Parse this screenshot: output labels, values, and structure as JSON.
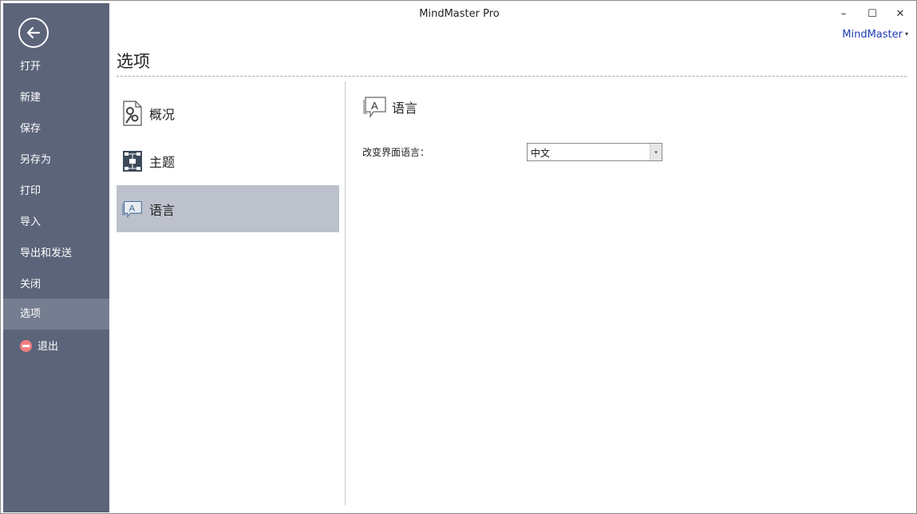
{
  "window": {
    "title": "MindMaster Pro",
    "controls": {
      "minimize": "–",
      "maximize": "☐",
      "close": "✕"
    },
    "brand_label": "MindMaster",
    "brand_caret": "▾"
  },
  "sidebar": {
    "back_icon": "back-arrow-icon",
    "items": [
      {
        "label": "打开"
      },
      {
        "label": "新建"
      },
      {
        "label": "保存"
      },
      {
        "label": "另存为"
      },
      {
        "label": "打印"
      },
      {
        "label": "导入"
      },
      {
        "label": "导出和发送"
      },
      {
        "label": "关闭"
      },
      {
        "label": "选项",
        "active": true
      },
      {
        "label": "退出",
        "icon": "exit-icon"
      }
    ],
    "colors": {
      "background": "#5b6479",
      "active": "#757d90"
    }
  },
  "page": {
    "title": "选项"
  },
  "categories": [
    {
      "label": "概况",
      "icon": "settings-gear-icon"
    },
    {
      "label": "主题",
      "icon": "theme-icon"
    },
    {
      "label": "语言",
      "icon": "language-icon",
      "active": true
    }
  ],
  "language_panel": {
    "heading": "语言",
    "field_label": "改变界面语言：",
    "select_value": "中文",
    "select_arrow": "▾"
  }
}
